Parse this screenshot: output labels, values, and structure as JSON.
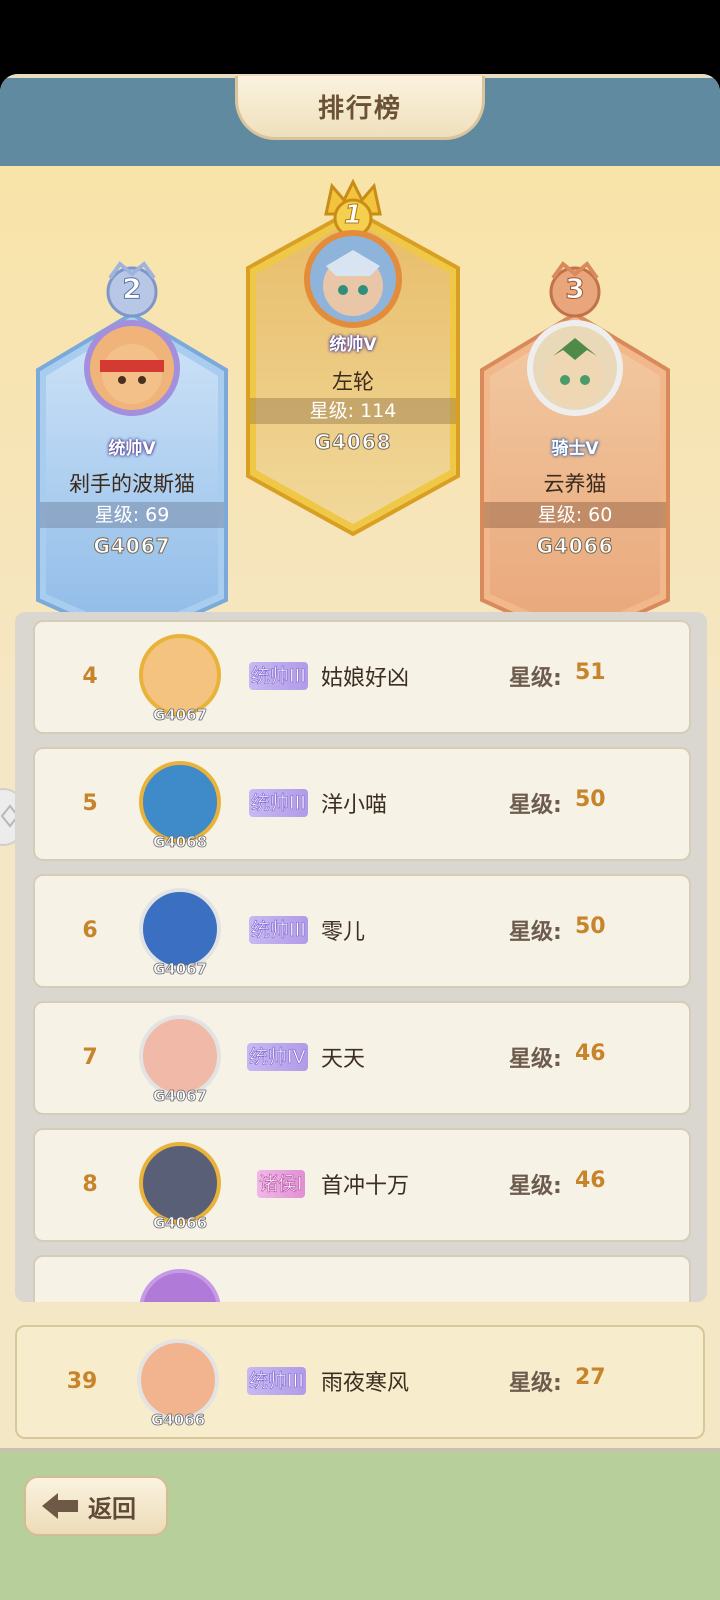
{
  "header": {
    "title": "排行榜"
  },
  "podium": [
    {
      "rank": "2",
      "title": "统帅V",
      "name": "剁手的波斯猫",
      "star_text": "星级: 69",
      "server": "G4067"
    },
    {
      "rank": "1",
      "title": "统帅V",
      "name": "左轮",
      "star_text": "星级: 114",
      "server": "G4068"
    },
    {
      "rank": "3",
      "title": "骑士V",
      "name": "云养猫",
      "star_text": "星级: 60",
      "server": "G4066"
    }
  ],
  "list": {
    "star_label": "星级:",
    "rows": [
      {
        "rank": "4",
        "title": "统帅III",
        "name": "姑娘好凶",
        "stars": "51",
        "server": "G4067"
      },
      {
        "rank": "5",
        "title": "统帅III",
        "name": "洋小喵",
        "stars": "50",
        "server": "G4068"
      },
      {
        "rank": "6",
        "title": "统帅III",
        "name": "零儿",
        "stars": "50",
        "server": "G4067"
      },
      {
        "rank": "7",
        "title": "统帅IV",
        "name": "天天",
        "stars": "46",
        "server": "G4067"
      },
      {
        "rank": "8",
        "title": "诸侯I",
        "name": "首冲十万",
        "stars": "46",
        "server": "G4066"
      }
    ]
  },
  "my_rank": {
    "rank": "39",
    "title": "统帅III",
    "name": "雨夜寒风",
    "stars": "27",
    "server": "G4066"
  },
  "footer": {
    "back_label": "返回"
  },
  "colors": {
    "header_blue": "#5f8aa0",
    "gold": "#c7842b",
    "title_purple": "#b19be8",
    "footer_green": "#b7cf9b"
  }
}
